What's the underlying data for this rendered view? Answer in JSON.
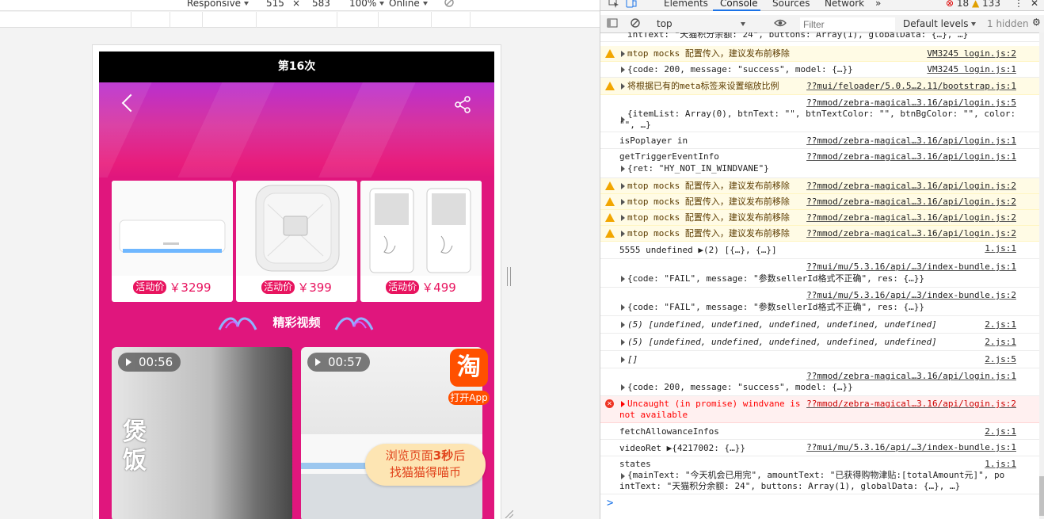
{
  "emulator": {
    "device": "Responsive",
    "width": "515",
    "times": "×",
    "height": "583",
    "zoom": "100%",
    "network": "Online"
  },
  "phone": {
    "title": "第16次",
    "products": [
      {
        "badge": "活动价",
        "price": "￥3299",
        "kind": "air-conditioner"
      },
      {
        "badge": "活动价",
        "price": "￥399",
        "kind": "fan"
      },
      {
        "badge": "活动价",
        "price": "￥499",
        "kind": "air-cooler"
      }
    ],
    "section_title": "精彩视频",
    "videos": [
      {
        "duration": "00:56",
        "overlay_text": "煲饭"
      },
      {
        "duration": "00:57",
        "overlay_text": ""
      }
    ],
    "taobao": {
      "icon_char": "淘",
      "label": "打开App"
    },
    "coin_tip": {
      "line1_pre": "浏览页面",
      "line1_bold": "3秒",
      "line1_post": "后",
      "line2": "找猫猫得喵币"
    }
  },
  "devtools": {
    "tabs": [
      "Elements",
      "Console",
      "Sources",
      "Network"
    ],
    "active_tab": "Console",
    "more": "»",
    "error_count": "18",
    "warning_count": "133",
    "context": "top",
    "filter_placeholder": "Filter",
    "levels": "Default levels",
    "hidden": "1 hidden",
    "colors": {
      "warn_bg": "#fffbe5",
      "error_bg": "#fff0f0",
      "accent": "#1a73e8"
    }
  },
  "console": {
    "top_partial": "intText: \"天猫积分余额: 24\", buttons: Array(1), globalData: {…}, …}",
    "rows": [
      {
        "type": "warn",
        "text": "mtop mocks 配置传入，建议发布前移除",
        "src": "VM3245 login.js:2"
      },
      {
        "type": "log",
        "text": "{code: 200, message: \"success\", model: {…}}",
        "src": "VM3245 login.js:1"
      },
      {
        "type": "warn",
        "text": "将根据已有的meta标签来设置缩放比例",
        "src": "??mui/feloader/5.0.5…2.11/bootstrap.js:1"
      },
      {
        "type": "log",
        "text": "{itemList: Array(0), btnText: \"\", btnTextColor: \"\", btnBgColor: \"\", color:",
        "text2": "\"\", …}",
        "src": "??mmod/zebra-magical…3.16/api/login.js:5"
      },
      {
        "type": "log",
        "text": "isPoplayer in",
        "src": "??mmod/zebra-magical…3.16/api/login.js:1"
      },
      {
        "type": "log",
        "text": "getTriggerEventInfo",
        "text2": "{ret: \"HY_NOT_IN_WINDVANE\"}",
        "src": "??mmod/zebra-magical…3.16/api/login.js:1"
      },
      {
        "type": "warn",
        "text": "mtop mocks 配置传入，建议发布前移除",
        "src": "??mmod/zebra-magical…3.16/api/login.js:2"
      },
      {
        "type": "warn",
        "text": "mtop mocks 配置传入，建议发布前移除",
        "src": "??mmod/zebra-magical…3.16/api/login.js:2"
      },
      {
        "type": "warn",
        "text": "mtop mocks 配置传入，建议发布前移除",
        "src": "??mmod/zebra-magical…3.16/api/login.js:2"
      },
      {
        "type": "warn",
        "text": "mtop mocks 配置传入，建议发布前移除",
        "src": "??mmod/zebra-magical…3.16/api/login.js:2"
      },
      {
        "type": "log",
        "text": "5555 undefined ▶(2) [{…}, {…}]",
        "src": "1.js:1"
      },
      {
        "type": "log",
        "text": "{code: \"FAIL\", message: \"参数sellerId格式不正确\", res: {…}}",
        "src": "??mui/mu/5.3.16/api/…3/index-bundle.js:1"
      },
      {
        "type": "log",
        "text": "{code: \"FAIL\", message: \"参数sellerId格式不正确\", res: {…}}",
        "src": "??mui/mu/5.3.16/api/…3/index-bundle.js:2"
      },
      {
        "type": "log",
        "text": "(5) [undefined, undefined, undefined, undefined, undefined]",
        "src": "2.js:1"
      },
      {
        "type": "log",
        "text": "(5) [undefined, undefined, undefined, undefined, undefined]",
        "src": "2.js:1"
      },
      {
        "type": "log",
        "text": "[]",
        "src": "2.js:5"
      },
      {
        "type": "log",
        "text": "{code: 200, message: \"success\", model: {…}}",
        "src": "??mmod/zebra-magical…3.16/api/login.js:1"
      },
      {
        "type": "error",
        "text": "Uncaught (in promise) windvane is",
        "text2": "not available",
        "src": "??mmod/zebra-magical…3.16/api/login.js:2"
      },
      {
        "type": "log",
        "text": "fetchAllowanceInfos",
        "src": "2.js:1"
      },
      {
        "type": "log",
        "text": "videoRet ▶{4217002: {…}}",
        "src": "??mui/mu/5.3.16/api/…3/index-bundle.js:1"
      },
      {
        "type": "log",
        "text": "states",
        "text2": "{mainText: \"今天机会已用完\", amountText: \"已获得购物津贴:[totalAmount元]\", po",
        "text3": "intText: \"天猫积分余额: 24\", buttons: Array(1), globalData: {…}, …}",
        "src": "1.js:1"
      }
    ],
    "prompt": ">"
  }
}
